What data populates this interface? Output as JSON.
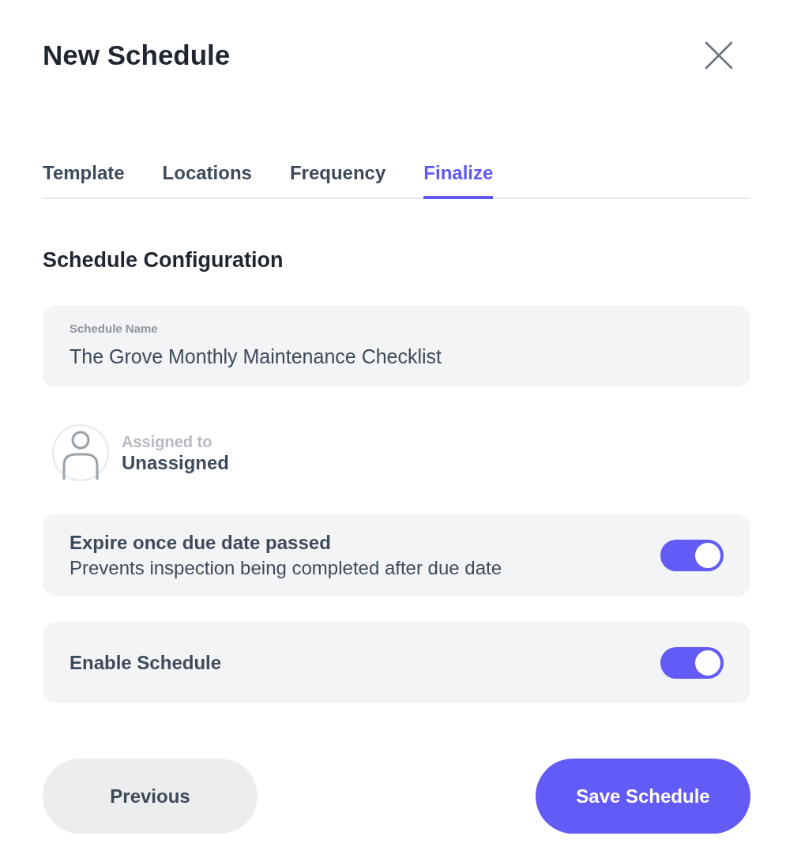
{
  "dialog": {
    "title": "New Schedule"
  },
  "tabs": [
    {
      "label": "Template",
      "selected": false
    },
    {
      "label": "Locations",
      "selected": false
    },
    {
      "label": "Frequency",
      "selected": false
    },
    {
      "label": "Finalize",
      "selected": true
    }
  ],
  "section": {
    "heading": "Schedule Configuration"
  },
  "schedule_name_field": {
    "label": "Schedule Name",
    "value": "The Grove Monthly Maintenance Checklist"
  },
  "assignee": {
    "label": "Assigned to",
    "value": "Unassigned"
  },
  "settings": [
    {
      "title": "Expire once due date passed",
      "description": "Prevents inspection being completed after due date",
      "on": true
    },
    {
      "title": "Enable Schedule",
      "on": true
    }
  ],
  "buttons": [
    {
      "label": "Previous",
      "kind": "secondary"
    },
    {
      "label": "Save Schedule",
      "kind": "primary"
    }
  ]
}
